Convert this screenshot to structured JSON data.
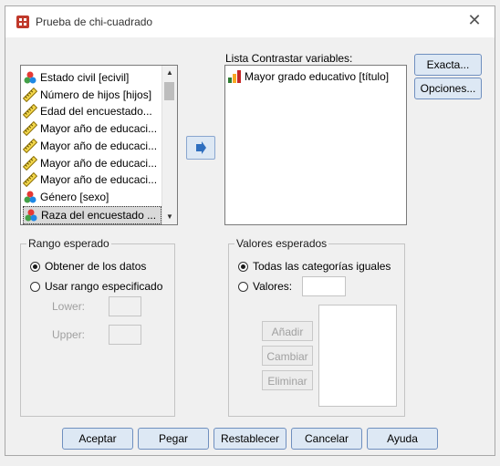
{
  "window": {
    "title": "Prueba de chi-cuadrado"
  },
  "source_list": {
    "items": [
      {
        "label": "Estado civil [ecivil]",
        "icon": "nominal-icon"
      },
      {
        "label": "Número de hijos [hijos]",
        "icon": "scale-icon"
      },
      {
        "label": "Edad del encuestado...",
        "icon": "scale-icon"
      },
      {
        "label": "Mayor año de educaci...",
        "icon": "scale-icon"
      },
      {
        "label": "Mayor año de educaci...",
        "icon": "scale-icon"
      },
      {
        "label": "Mayor año de educaci...",
        "icon": "scale-icon"
      },
      {
        "label": "Mayor año de educaci...",
        "icon": "scale-icon"
      },
      {
        "label": "Género [sexo]",
        "icon": "nominal-icon"
      },
      {
        "label": "Raza del encuestado ...",
        "icon": "nominal-icon",
        "selected": true
      }
    ]
  },
  "target_list": {
    "label": "Lista Contrastar variables:",
    "items": [
      {
        "label": "Mayor grado educativo [título]",
        "icon": "ordinal-icon"
      }
    ]
  },
  "side_buttons": {
    "exact": "Exacta...",
    "options": "Opciones..."
  },
  "expected_range": {
    "legend": "Rango esperado",
    "option_data": "Obtener de los datos",
    "option_specified": "Usar rango especificado",
    "lower_label": "Lower:",
    "upper_label": "Upper:"
  },
  "expected_values": {
    "legend": "Valores esperados",
    "option_all_equal": "Todas las categorías iguales",
    "option_values": "Valores:",
    "add": "Añadir",
    "change": "Cambiar",
    "remove": "Eliminar"
  },
  "footer": {
    "ok": "Aceptar",
    "paste": "Pegar",
    "reset": "Restablecer",
    "cancel": "Cancelar",
    "help": "Ayuda"
  },
  "colors": {
    "accent": "#dde8f4",
    "accent_border": "#6f8fbf"
  }
}
